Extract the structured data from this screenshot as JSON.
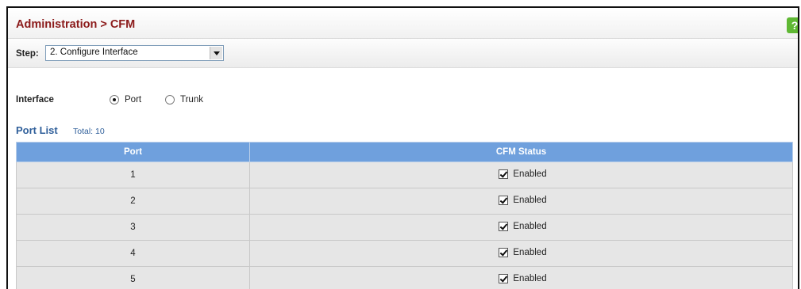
{
  "header": {
    "title": "Administration > CFM",
    "help_icon": "?"
  },
  "step": {
    "label": "Step:",
    "selected": "2. Configure Interface"
  },
  "interface": {
    "label": "Interface",
    "options": [
      {
        "label": "Port",
        "checked": true
      },
      {
        "label": "Trunk",
        "checked": false
      }
    ]
  },
  "port_list": {
    "title": "Port List",
    "total": "Total: 10",
    "columns": [
      "Port",
      "CFM Status"
    ],
    "rows": [
      {
        "port": "1",
        "status": "Enabled",
        "checked": true
      },
      {
        "port": "2",
        "status": "Enabled",
        "checked": true
      },
      {
        "port": "3",
        "status": "Enabled",
        "checked": true
      },
      {
        "port": "4",
        "status": "Enabled",
        "checked": true
      },
      {
        "port": "5",
        "status": "Enabled",
        "checked": true
      }
    ]
  },
  "colors": {
    "title": "#8b1a1a",
    "table_header": "#6fa0dd",
    "row_bg": "#e6e6e6",
    "help_icon": "#5fb833"
  }
}
